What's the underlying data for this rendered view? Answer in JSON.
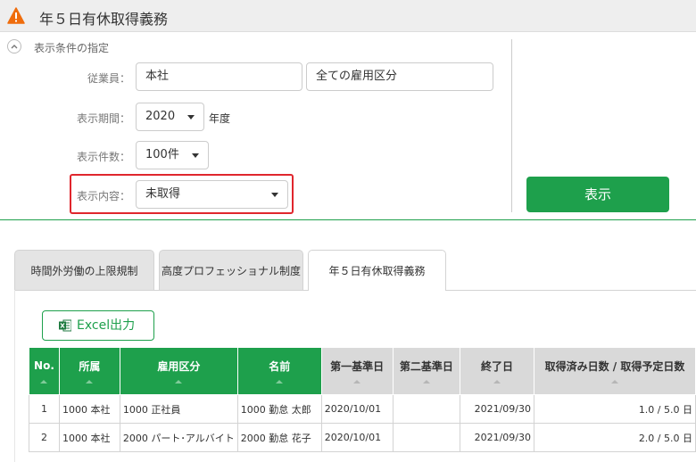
{
  "header": {
    "title": "年５日有休取得義務"
  },
  "conditions": {
    "title": "表示条件の指定",
    "employee_label": "従業員：",
    "employee_value": "本社",
    "employment_type_value": "全ての雇用区分",
    "period_label": "表示期間：",
    "period_value": "2020",
    "period_unit": "年度",
    "count_label": "表示件数：",
    "count_value": "100件",
    "content_label": "表示内容：",
    "content_value": "未取得",
    "show_button": "表示"
  },
  "tabs": [
    {
      "label": "時間外労働の上限規制",
      "active": false
    },
    {
      "label": "高度プロフェッショナル制度",
      "active": false
    },
    {
      "label": "年５日有休取得義務",
      "active": true
    }
  ],
  "excel_button": "Excel出力",
  "table": {
    "headers": [
      "No.",
      "所属",
      "雇用区分",
      "名前",
      "第一基準日",
      "第二基準日",
      "終了日",
      "取得済み日数 / 取得予定日数"
    ],
    "rows": [
      [
        "1",
        "1000 本社",
        "1000 正社員",
        "1000 勤怠 太郎",
        "2020/10/01",
        "",
        "2021/09/30",
        "1.0 / 5.0 日"
      ],
      [
        "2",
        "1000 本社",
        "2000 パート･アルバイト",
        "2000 勤怠 花子",
        "2020/10/01",
        "",
        "2021/09/30",
        "2.0 / 5.0 日"
      ]
    ]
  },
  "colors": {
    "accent": "#1ea04c",
    "highlight": "#e0262d",
    "warning": "#ef6c0c"
  },
  "icons": {
    "header": "warning-icon",
    "toggle": "chevron-up-icon",
    "excel": "excel-icon"
  }
}
